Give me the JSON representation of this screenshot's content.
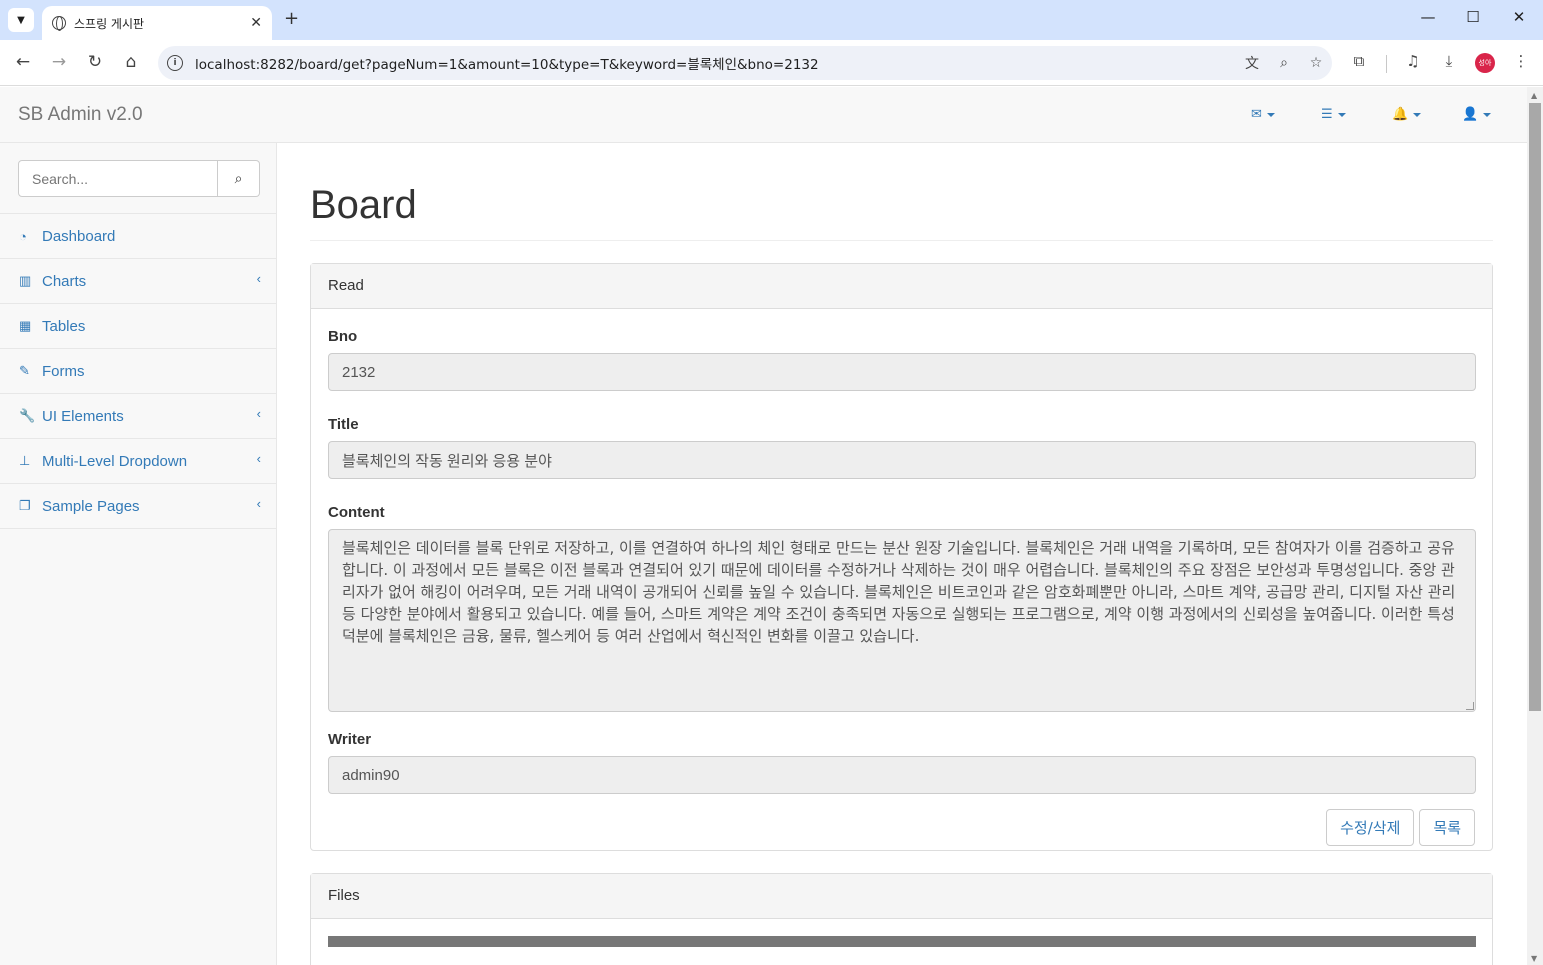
{
  "browser": {
    "tab_title": "스프링 게시판",
    "url": "localhost:8282/board/get?pageNum=1&amount=10&type=T&keyword=블록체인&bno=2132",
    "profile_label": "성아"
  },
  "app": {
    "brand": "SB Admin v2.0"
  },
  "sidebar": {
    "search_placeholder": "Search...",
    "items": [
      {
        "label": "Dashboard",
        "icon": "dashboard-icon",
        "has_submenu": false
      },
      {
        "label": "Charts",
        "icon": "bar-chart-icon",
        "has_submenu": true
      },
      {
        "label": "Tables",
        "icon": "table-icon",
        "has_submenu": false
      },
      {
        "label": "Forms",
        "icon": "edit-icon",
        "has_submenu": false
      },
      {
        "label": "UI Elements",
        "icon": "wrench-icon",
        "has_submenu": true
      },
      {
        "label": "Multi-Level Dropdown",
        "icon": "sitemap-icon",
        "has_submenu": true
      },
      {
        "label": "Sample Pages",
        "icon": "files-icon",
        "has_submenu": true
      }
    ]
  },
  "main": {
    "title": "Board",
    "read_panel": {
      "heading": "Read",
      "bno_label": "Bno",
      "bno_value": "2132",
      "title_label": "Title",
      "title_value": "블록체인의 작동 원리와 응용 분야",
      "content_label": "Content",
      "content_value": "블록체인은 데이터를 블록 단위로 저장하고, 이를 연결하여 하나의 체인 형태로 만드는 분산 원장 기술입니다. 블록체인은 거래 내역을 기록하며, 모든 참여자가 이를 검증하고 공유합니다. 이 과정에서 모든 블록은 이전 블록과 연결되어 있기 때문에 데이터를 수정하거나 삭제하는 것이 매우 어렵습니다. 블록체인의 주요 장점은 보안성과 투명성입니다. 중앙 관리자가 없어 해킹이 어려우며, 모든 거래 내역이 공개되어 신뢰를 높일 수 있습니다. 블록체인은 비트코인과 같은 암호화폐뿐만 아니라, 스마트 계약, 공급망 관리, 디지털 자산 관리 등 다양한 분야에서 활용되고 있습니다. 예를 들어, 스마트 계약은 계약 조건이 충족되면 자동으로 실행되는 프로그램으로, 계약 이행 과정에서의 신뢰성을 높여줍니다. 이러한 특성 덕분에 블록체인은 금융, 물류, 헬스케어 등 여러 산업에서 혁신적인 변화를 이끌고 있습니다.",
      "writer_label": "Writer",
      "writer_value": "admin90",
      "modify_button": "수정/삭제",
      "list_button": "목록"
    },
    "files_panel": {
      "heading": "Files"
    }
  },
  "colors": {
    "link": "#337ab7",
    "navbar_bg": "#f8f8f8",
    "field_bg": "#eeeeee"
  }
}
